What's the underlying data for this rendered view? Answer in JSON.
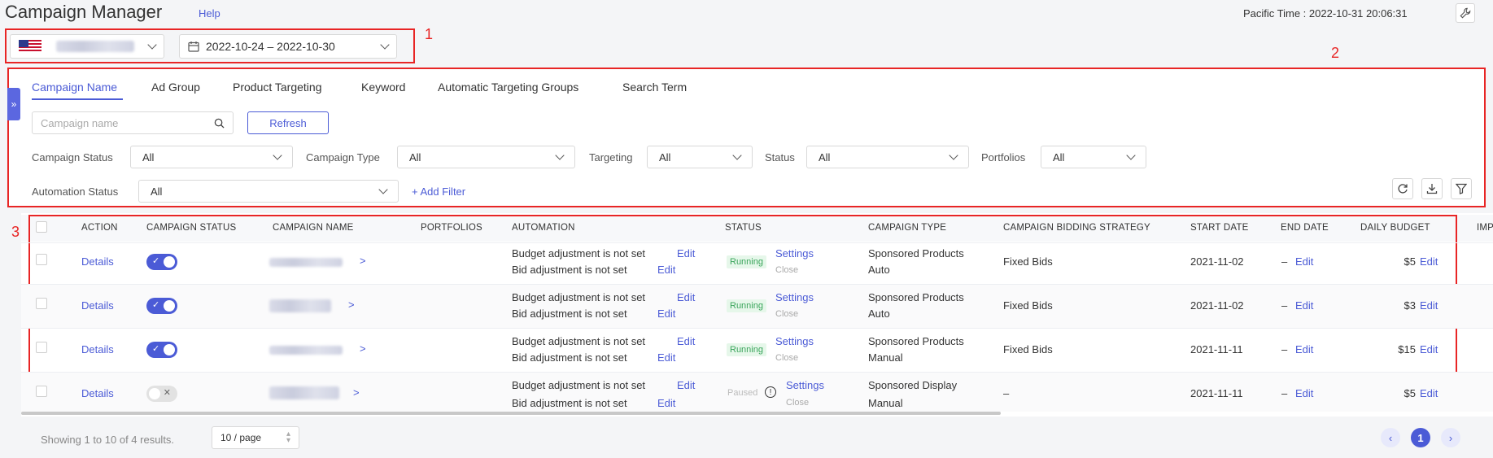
{
  "header": {
    "title": "Campaign Manager",
    "help": "Help",
    "time": "Pacific Time : 2022-10-31 20:06:31"
  },
  "selectors": {
    "date_range": "2022-10-24 – 2022-10-30"
  },
  "annotations": [
    "1",
    "2",
    "3"
  ],
  "tabs": [
    "Campaign Name",
    "Ad Group",
    "Product Targeting",
    "Keyword",
    "Automatic Targeting Groups",
    "Search Term"
  ],
  "search": {
    "placeholder": "Campaign name",
    "refresh": "Refresh"
  },
  "filters": {
    "campaign_status": {
      "label": "Campaign Status",
      "value": "All"
    },
    "campaign_type": {
      "label": "Campaign Type",
      "value": "All"
    },
    "targeting": {
      "label": "Targeting",
      "value": "All"
    },
    "status": {
      "label": "Status",
      "value": "All"
    },
    "portfolios": {
      "label": "Portfolios",
      "value": "All"
    },
    "automation_status": {
      "label": "Automation Status",
      "value": "All"
    },
    "add_filter": "+ Add Filter"
  },
  "table": {
    "columns": [
      "ACTION",
      "CAMPAIGN STATUS",
      "CAMPAIGN NAME",
      "PORTFOLIOS",
      "AUTOMATION",
      "STATUS",
      "CAMPAIGN TYPE",
      "CAMPAIGN BIDDING STRATEGY",
      "START DATE",
      "END DATE",
      "DAILY BUDGET",
      "IMPI"
    ],
    "rows": [
      {
        "action": "Details",
        "enabled": true,
        "budget_adj": "Budget adjustment is not set",
        "bid_adj": "Bid adjustment is not set",
        "edit": "Edit",
        "status": "Running",
        "settings": "Settings",
        "close": "Close",
        "type_line1": "Sponsored Products",
        "type_line2": "Auto",
        "bidding": "Fixed Bids",
        "start": "2021-11-02",
        "end": "–",
        "budget": "$5"
      },
      {
        "action": "Details",
        "enabled": true,
        "budget_adj": "Budget adjustment is not set",
        "bid_adj": "Bid adjustment is not set",
        "edit": "Edit",
        "status": "Running",
        "settings": "Settings",
        "close": "Close",
        "type_line1": "Sponsored Products",
        "type_line2": "Auto",
        "bidding": "Fixed Bids",
        "start": "2021-11-02",
        "end": "–",
        "budget": "$3"
      },
      {
        "action": "Details",
        "enabled": true,
        "budget_adj": "Budget adjustment is not set",
        "bid_adj": "Bid adjustment is not set",
        "edit": "Edit",
        "status": "Running",
        "settings": "Settings",
        "close": "Close",
        "type_line1": "Sponsored Products",
        "type_line2": "Manual",
        "bidding": "Fixed Bids",
        "start": "2021-11-11",
        "end": "–",
        "budget": "$15"
      },
      {
        "action": "Details",
        "enabled": false,
        "budget_adj": "Budget adjustment is not set",
        "bid_adj": "Bid adjustment is not set",
        "edit": "Edit",
        "status": "Paused",
        "settings": "Settings",
        "close": "Close",
        "type_line1": "Sponsored Display",
        "type_line2": "Manual",
        "bidding": "–",
        "start": "2021-11-11",
        "end": "–",
        "budget": "$5"
      }
    ]
  },
  "footer": {
    "showing": "Showing 1 to 10 of 4 results.",
    "page_size": "10 / page",
    "current_page": "1"
  },
  "colors": {
    "accent": "#4b5bd6",
    "annotation": "#e82525",
    "running": "#3aa55b"
  }
}
